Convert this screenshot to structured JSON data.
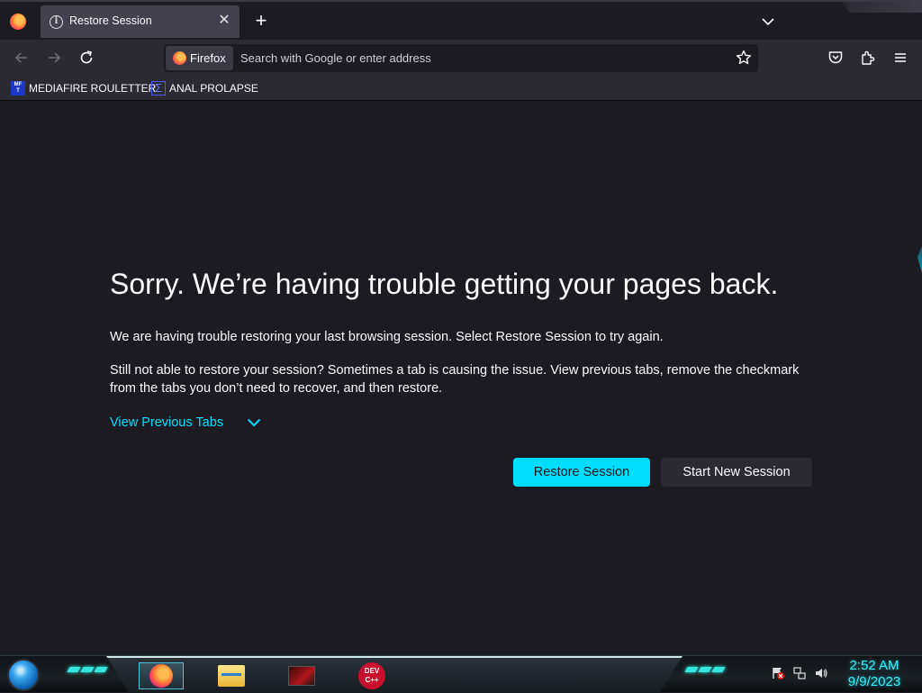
{
  "tab": {
    "title": "Restore Session",
    "icon": "info-icon"
  },
  "navbar": {
    "identity_label": "Firefox",
    "url_placeholder": "Search with Google or enter address"
  },
  "bookmarks": [
    {
      "label": "MEDIAFIRE ROULETTER",
      "icon": "mediafire-icon",
      "icon_text": "MF T"
    },
    {
      "label": "ANAL PROLAPSE",
      "icon": "sigma-icon"
    }
  ],
  "content": {
    "title": "Sorry. We’re having trouble getting your pages back.",
    "paragraph1": "We are having trouble restoring your last browsing session. Select Restore Session to try again.",
    "paragraph2": "Still not able to restore your session? Sometimes a tab is causing the issue. View previous tabs, remove the checkmark from the tabs you don’t need to recover, and then restore.",
    "view_previous_tabs": "View Previous Tabs",
    "restore_button": "Restore Session",
    "new_session_button": "Start New Session"
  },
  "taskbar": {
    "apps": [
      "firefox",
      "file-explorer",
      "red-app",
      "dev-cpp"
    ],
    "devcpp_label": "DEV C++",
    "clock_time": "2:52 AM",
    "clock_date": "9/9/2023"
  },
  "colors": {
    "accent": "#00ddff",
    "background": "#1c1b22",
    "toolbar": "#2b2a33",
    "tab_selected": "#42414d",
    "text": "#fbfbfe"
  }
}
